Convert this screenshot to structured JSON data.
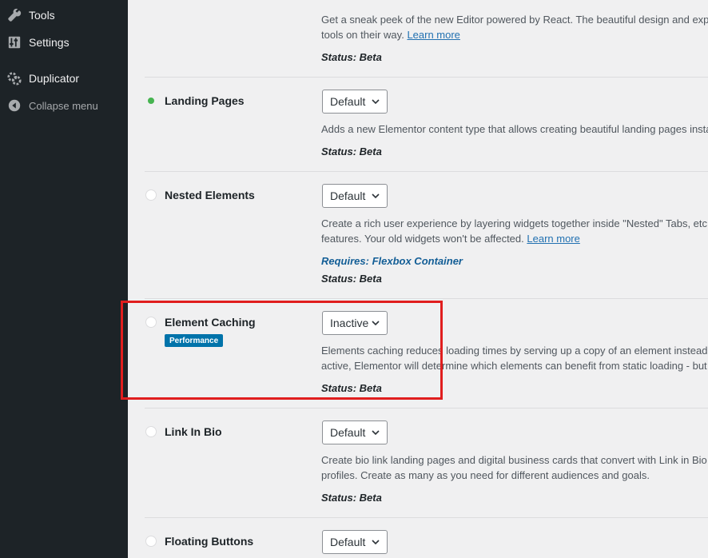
{
  "sidebar": {
    "items": [
      {
        "label": "Tools",
        "icon": "wrench-icon"
      },
      {
        "label": "Settings",
        "icon": "settings-sliders-icon"
      },
      {
        "label": "Duplicator",
        "icon": "duplicator-gear-icon"
      },
      {
        "label": "Collapse menu",
        "icon": "collapse-arrow-icon"
      }
    ]
  },
  "features": [
    {
      "desc_line1": "Get a sneak peek of the new Editor powered by React. The beautiful design and experin",
      "desc_line2": "tools on their way.",
      "link": "Learn more",
      "status": "Status: Beta"
    },
    {
      "name": "Landing Pages",
      "state": "active",
      "select": "Default",
      "desc_line1": "Adds a new Elementor content type that allows creating beautiful landing pages instant",
      "status": "Status: Beta"
    },
    {
      "name": "Nested Elements",
      "state": "default",
      "select": "Default",
      "desc_line1": "Create a rich user experience by layering widgets together inside \"Nested\" Tabs, etc. Wh",
      "desc_line2": "features. Your old widgets won't be affected.",
      "link": "Learn more",
      "requires": "Requires: Flexbox Container",
      "status": "Status: Beta"
    },
    {
      "name": "Element Caching",
      "state": "inactive",
      "select": "Inactive",
      "badge": "Performance",
      "desc_line1": "Elements caching reduces loading times by serving up a copy of an element instead of r",
      "desc_line2": "active, Elementor will determine which elements can benefit from static loading - but yo",
      "status": "Status: Beta"
    },
    {
      "name": "Link In Bio",
      "state": "default",
      "select": "Default",
      "desc_line1": "Create bio link landing pages and digital business cards that convert with Link in Bio wic",
      "desc_line2": "profiles. Create as many as you need for different audiences and goals.",
      "status": "Status: Beta"
    },
    {
      "name": "Floating Buttons",
      "state": "default",
      "select": "Default"
    }
  ],
  "colors": {
    "sidebar_bg": "#1d2327",
    "active_dot": "#46b450",
    "badge_bg": "#0073aa",
    "link": "#2271b1",
    "highlight": "#e01e1e"
  }
}
